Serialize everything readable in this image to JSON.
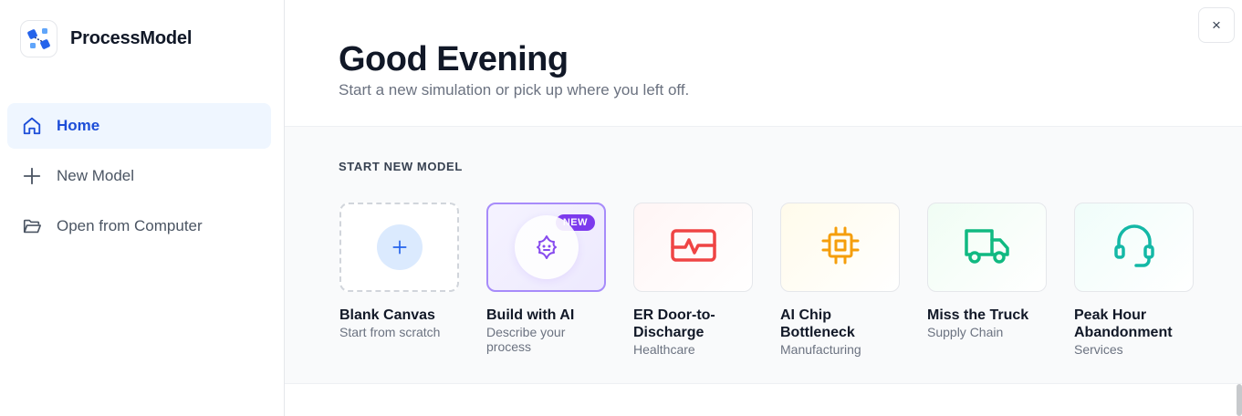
{
  "brand": {
    "name": "ProcessModel"
  },
  "sidebar": {
    "items": [
      {
        "label": "Home",
        "icon": "home-icon",
        "active": true
      },
      {
        "label": "New Model",
        "icon": "plus-icon",
        "active": false
      },
      {
        "label": "Open from Computer",
        "icon": "folder-open-icon",
        "active": false
      }
    ]
  },
  "header": {
    "greeting": "Good Evening",
    "subtitle": "Start a new simulation or pick up where you left off.",
    "close_label": "×"
  },
  "section": {
    "title": "START NEW MODEL",
    "cards": [
      {
        "title": "Blank Canvas",
        "subtitle": "Start from scratch",
        "icon": "plus-icon"
      },
      {
        "title": "Build with AI",
        "subtitle": "Describe your process",
        "icon": "ai-sparkle-icon",
        "badge": "NEW"
      },
      {
        "title": "ER Door-to-Discharge",
        "subtitle": "Healthcare",
        "icon": "heart-monitor-icon"
      },
      {
        "title": "AI Chip Bottleneck",
        "subtitle": "Manufacturing",
        "icon": "cpu-chip-icon"
      },
      {
        "title": "Miss the Truck",
        "subtitle": "Supply Chain",
        "icon": "truck-icon"
      },
      {
        "title": "Peak Hour Abandonment",
        "subtitle": "Services",
        "icon": "headset-icon"
      }
    ]
  },
  "colors": {
    "accent": "#1d4ed8",
    "ai_purple": "#7c3aed",
    "er_red": "#ef4444",
    "chip_amber": "#f59e0b",
    "truck_green": "#10b981",
    "headset_teal": "#14b8a6"
  }
}
